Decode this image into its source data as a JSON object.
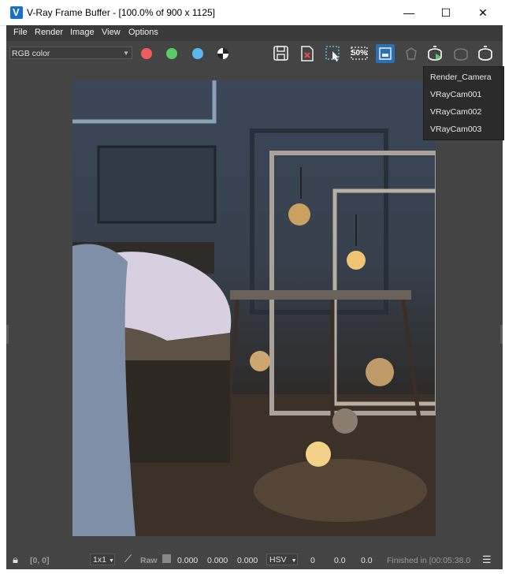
{
  "window": {
    "title": "V-Ray Frame Buffer - [100.0% of 900 x 1125]",
    "minimize_glyph": "—",
    "maximize_glyph": "☐",
    "close_glyph": "✕",
    "app_icon_letter": "V"
  },
  "menu": {
    "items": [
      "File",
      "Render",
      "Image",
      "View",
      "Options"
    ]
  },
  "toolbar": {
    "channel_select": "RGB color",
    "color_dots": {
      "red": "#f15b5b",
      "green": "#58cc66",
      "blue": "#5ab8ee"
    },
    "zoom_badge": "50%"
  },
  "camera_menu": {
    "items": [
      "Render_Camera",
      "VRayCam001",
      "VRayCam002",
      "VRayCam003"
    ]
  },
  "statusbar": {
    "coords": "[0, 0]",
    "ratio": "1x1",
    "raw_label": "Raw",
    "values": [
      "0.000",
      "0.000",
      "0.000"
    ],
    "color_mode": "HSV",
    "hsv_values": [
      "0",
      "0.0",
      "0.0"
    ],
    "finished": "Finished in [00:05:38.0"
  },
  "colors": {
    "frame_bg": "#444444",
    "menu_bg": "#3a3a3a",
    "accent_blue": "#1a6fc8"
  }
}
